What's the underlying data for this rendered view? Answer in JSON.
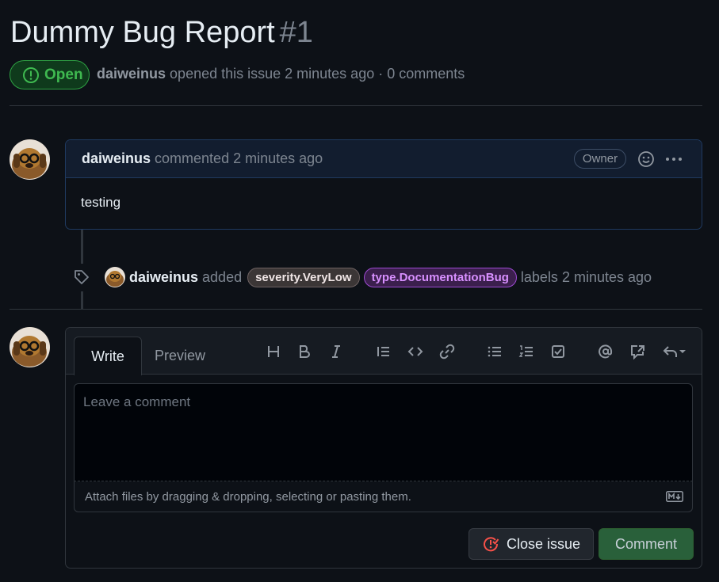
{
  "issue": {
    "title": "Dummy Bug Report",
    "number": "#1",
    "state": "Open",
    "author": "daiweinus",
    "meta_text": "opened this issue 2 minutes ago · 0 comments"
  },
  "comment": {
    "author": "daiweinus",
    "action": "commented 2 minutes ago",
    "role_badge": "Owner",
    "body": "testing"
  },
  "event": {
    "actor": "daiweinus",
    "action": "added",
    "labels": [
      {
        "name": "severity.VeryLow",
        "color": "#6e6262"
      },
      {
        "name": "type.DocumentationBug",
        "color": "#9e4ad3"
      }
    ],
    "suffix": "labels 2 minutes ago"
  },
  "editor": {
    "tabs": [
      "Write",
      "Preview"
    ],
    "placeholder": "Leave a comment",
    "attach_text": "Attach files by dragging & dropping, selecting or pasting them.",
    "toolbar": [
      "heading-icon",
      "bold-icon",
      "italic-icon",
      "quote-icon",
      "code-icon",
      "link-icon",
      "bulleted-list-icon",
      "numbered-list-icon",
      "task-list-icon",
      "mention-icon",
      "cross-reference-icon",
      "saved-reply-icon"
    ],
    "close_label": "Close issue",
    "comment_label": "Comment"
  },
  "colors": {
    "open_green": "#3fb950",
    "comment_button": "#29603a",
    "close_icon_red": "#f85149"
  }
}
